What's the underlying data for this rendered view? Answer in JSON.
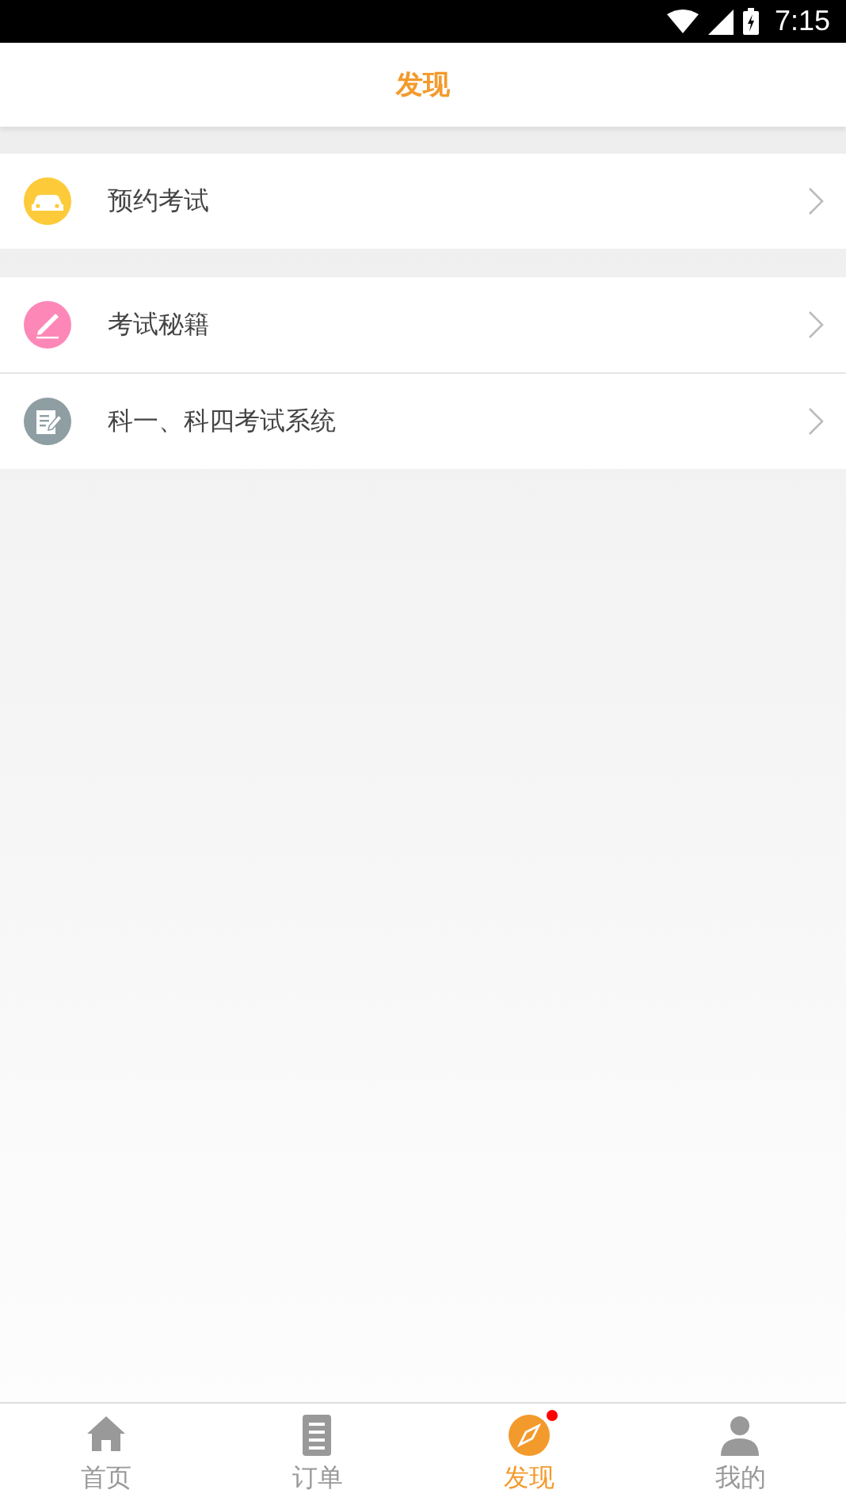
{
  "status_bar": {
    "time": "7:15"
  },
  "header": {
    "title": "发现"
  },
  "groups": [
    {
      "items": [
        {
          "label": "预约考试",
          "kind": "car",
          "color": "#fdcb3a"
        }
      ]
    },
    {
      "items": [
        {
          "label": "考试秘籍",
          "kind": "pen",
          "color": "#fd88b8"
        },
        {
          "label": "科一、科四考试系统",
          "kind": "note",
          "color": "#8e9ea3"
        }
      ]
    }
  ],
  "tabs": [
    {
      "label": "首页",
      "kind": "home",
      "selected": false,
      "badge": false
    },
    {
      "label": "订单",
      "kind": "list",
      "selected": false,
      "badge": false
    },
    {
      "label": "发现",
      "kind": "compass",
      "selected": true,
      "badge": true
    },
    {
      "label": "我的",
      "kind": "person",
      "selected": false,
      "badge": false
    }
  ]
}
